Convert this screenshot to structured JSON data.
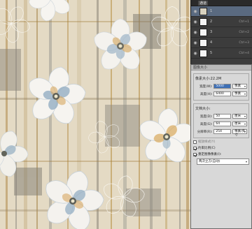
{
  "layers_panel": {
    "tabs": [
      "",
      "通道"
    ],
    "rows": [
      {
        "name": "1",
        "value": "",
        "kind": "pattern"
      },
      {
        "name": "2",
        "value": "Ctrl+1",
        "kind": "white"
      },
      {
        "name": "3",
        "value": "Ctrl+2",
        "kind": "white"
      },
      {
        "name": "4",
        "value": "Ctrl+3",
        "kind": "white"
      },
      {
        "name": "5",
        "value": "Ctrl+4",
        "kind": "white"
      },
      {
        "name": "6",
        "value": "Ctrl+5",
        "kind": "white"
      }
    ]
  },
  "dialog": {
    "title": "图像大小",
    "pixel_group": {
      "title": "像素大小:22.2M",
      "width_label": "宽度(W):",
      "width_value": "5000",
      "width_unit": "像素",
      "height_label": "高度(H):",
      "height_value": "6400",
      "height_unit": "像素"
    },
    "doc_group": {
      "title": "文档大小:",
      "width_label": "宽度(D):",
      "width_value": "50",
      "width_unit": "厘米",
      "height_label": "高度(G):",
      "height_value": "64",
      "height_unit": "厘米",
      "res_label": "分辨率(R):",
      "res_value": "254",
      "res_unit": "像素/英寸"
    },
    "checks": [
      {
        "label": "缩放样式(Y)",
        "checked": false,
        "dim": true
      },
      {
        "label": "约束比例(C)",
        "checked": true,
        "dim": false
      },
      {
        "label": "重定图像像素(I):",
        "checked": true,
        "dim": false
      }
    ],
    "resample": "两次立方(自动)"
  }
}
